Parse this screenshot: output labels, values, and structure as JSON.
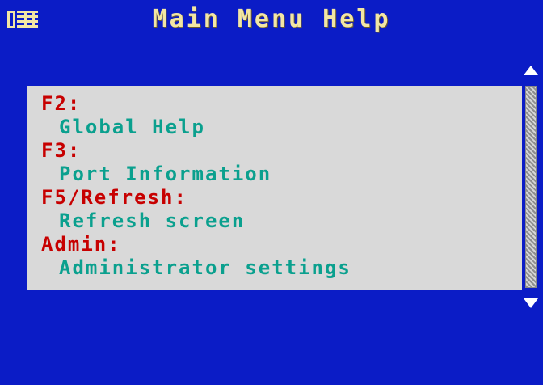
{
  "window": {
    "title": "Main Menu Help",
    "logo_icon": "kvm-logo-icon",
    "background_color": "#0b1cc6",
    "title_color": "#f2e6a4"
  },
  "help": {
    "panel_color": "#d9d9d9",
    "key_color": "#c70000",
    "description_color": "#0aa08e",
    "items": [
      {
        "key": "F2:",
        "description": "Global Help"
      },
      {
        "key": "F3:",
        "description": "Port Information"
      },
      {
        "key": "F5/Refresh:",
        "description": "Refresh screen"
      },
      {
        "key": "Admin:",
        "description": "Administrator settings"
      }
    ]
  },
  "scrollbar": {
    "up_icon": "scroll-up-arrow-icon",
    "down_icon": "scroll-down-arrow-icon"
  }
}
